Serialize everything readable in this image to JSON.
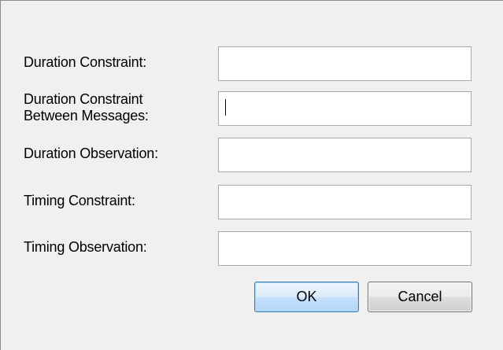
{
  "dialog": {
    "fields": [
      {
        "label": "Duration Constraint:",
        "value": "",
        "focused": false
      },
      {
        "label": "Duration Constraint\nBetween Messages:",
        "value": "",
        "focused": true
      },
      {
        "label": "Duration Observation:",
        "value": "",
        "focused": false
      },
      {
        "label": "Timing Constraint:",
        "value": "",
        "focused": false
      },
      {
        "label": "Timing Observation:",
        "value": "",
        "focused": false
      }
    ],
    "buttons": {
      "ok_label": "OK",
      "cancel_label": "Cancel"
    }
  },
  "colors": {
    "dialog_background": "#f0f0f0",
    "input_border": "#abadb3",
    "default_button_border": "#3c7fb1",
    "default_button_fill": "#dcecfc"
  }
}
